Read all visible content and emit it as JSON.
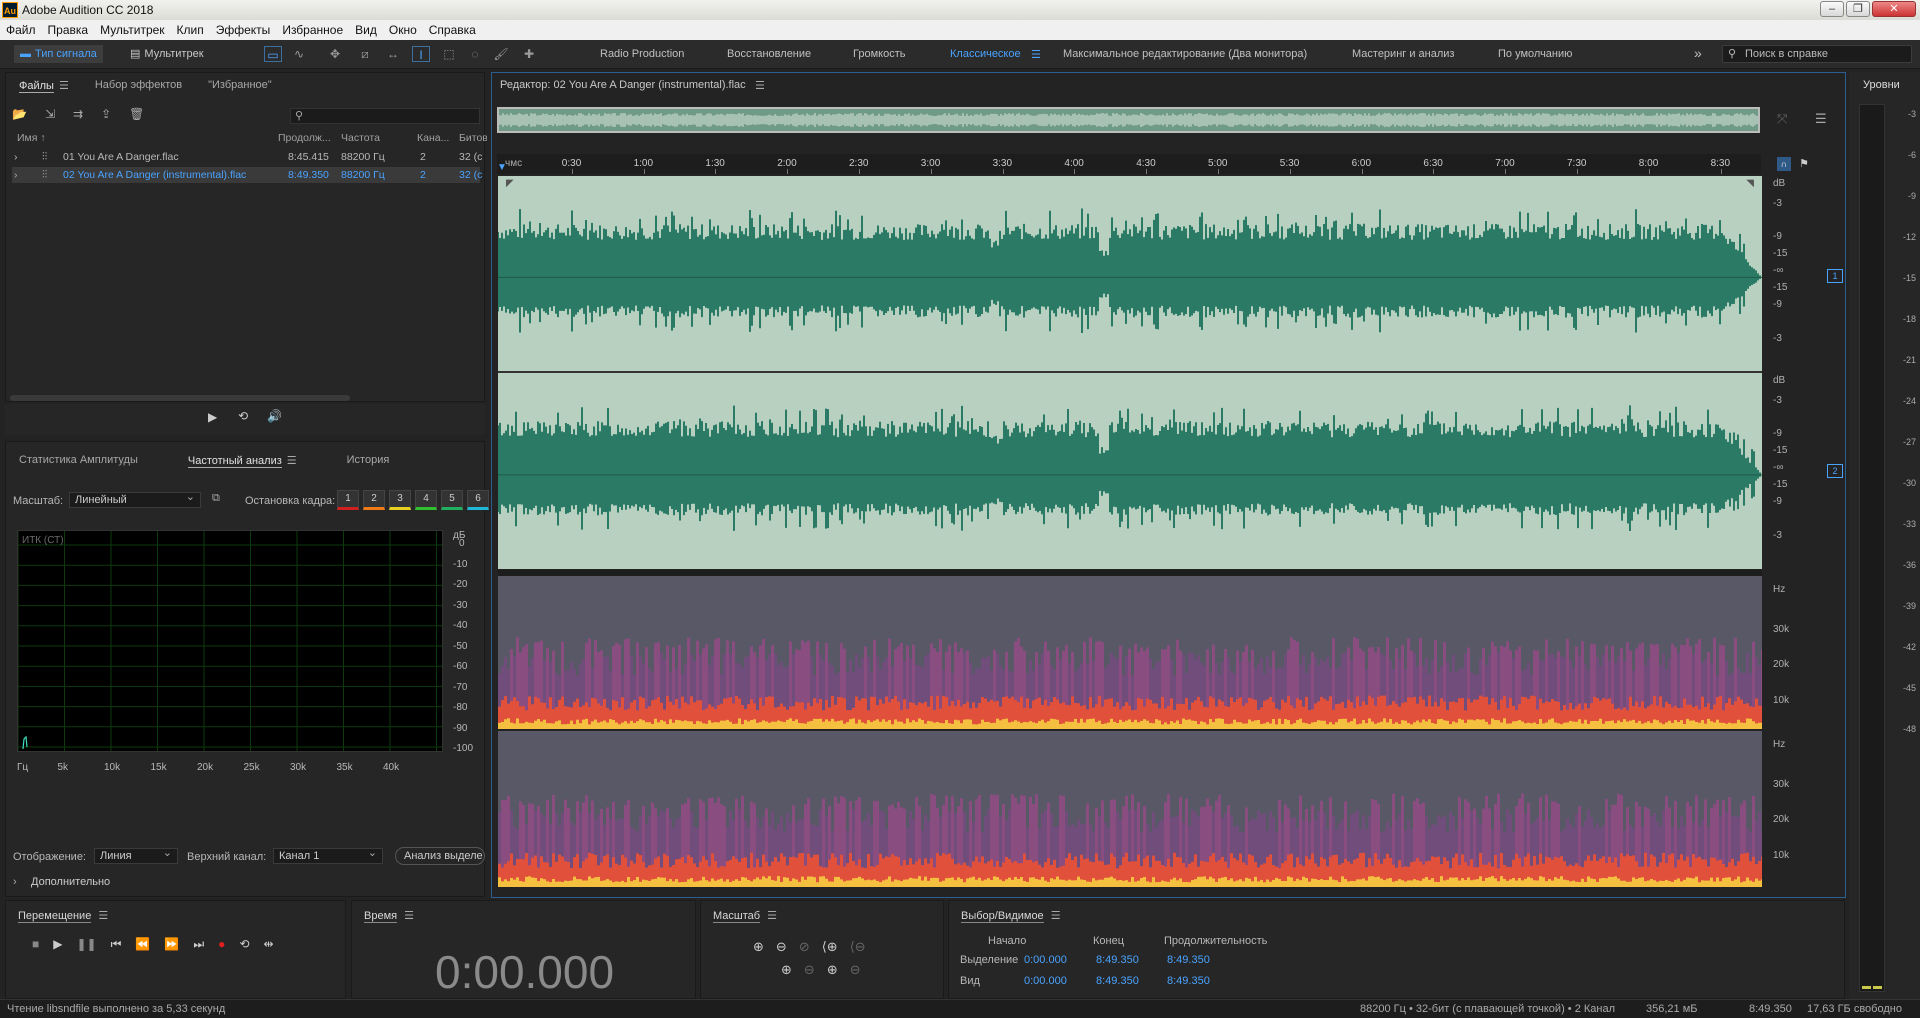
{
  "titlebar": {
    "logo": "Au",
    "title": "Adobe Audition CC 2018"
  },
  "menu": [
    "Файл",
    "Правка",
    "Мультитрек",
    "Клип",
    "Эффекты",
    "Избранное",
    "Вид",
    "Окно",
    "Справка"
  ],
  "toolbar": {
    "waveform_mode": "Тип сигнала",
    "multitrack_mode": "Мультитрек",
    "workspaces": [
      "Radio Production",
      "Восстановление",
      "Громкость",
      "Классическое",
      "Максимальное редактирование (Два монитора)",
      "Мастеринг и анализ",
      "По умолчанию"
    ],
    "active_workspace": "Классическое",
    "overflow": "»",
    "help_placeholder": "Поиск в справке"
  },
  "files_panel": {
    "tabs": [
      "Файлы",
      "Набор эффектов",
      "\"Избранное\""
    ],
    "columns": [
      "Имя",
      "Продолж...",
      "Частота",
      "Кана...",
      "Битов"
    ],
    "rows": [
      {
        "name": "01 You Are A Danger.flac",
        "duration": "8:45.415",
        "rate": "88200 Гц",
        "channels": "2",
        "bits": "32 (с"
      },
      {
        "name": "02 You Are A Danger (instrumental).flac",
        "duration": "8:49.350",
        "rate": "88200 Гц",
        "channels": "2",
        "bits": "32 (с"
      }
    ]
  },
  "analysis_panel": {
    "tabs": [
      "Статистика Амплитуды",
      "Частотный анализ",
      "История"
    ],
    "scale_label": "Масштаб:",
    "scale_value": "Линейный",
    "freeze_label": "Остановка кадра:",
    "freeze_slots": [
      "1",
      "2",
      "3",
      "4",
      "5",
      "6"
    ],
    "freeze_colors": [
      "#d02020",
      "#f07a18",
      "#e8d020",
      "#30c030",
      "#20b060",
      "#20b8d8"
    ],
    "graph_label": "ИТК (СТ)",
    "db_unit": "дБ",
    "db_ticks": [
      "0",
      "-10",
      "-20",
      "-30",
      "-40",
      "-50",
      "-60",
      "-70",
      "-80",
      "-90",
      "-100"
    ],
    "hz_ticks": [
      "Гц",
      "5k",
      "10k",
      "15k",
      "20k",
      "25k",
      "30k",
      "35k",
      "40k"
    ],
    "display_label": "Отображение:",
    "display_value": "Линия",
    "channel_label": "Верхний канал:",
    "channel_value": "Канал 1",
    "analyze_button": "Анализ выделе",
    "advanced": "Дополнительно"
  },
  "editor": {
    "title": "Редактор: 02 You Are A Danger (instrumental).flac",
    "ruler_start": "чмс",
    "ruler_ticks": [
      "0:30",
      "1:00",
      "1:30",
      "2:00",
      "2:30",
      "3:00",
      "3:30",
      "4:00",
      "4:30",
      "5:00",
      "5:30",
      "6:00",
      "6:30",
      "7:00",
      "7:30",
      "8:00",
      "8:30"
    ],
    "db_unit": "dB",
    "db_ticks": [
      "-3",
      "-9",
      "-15",
      "-∞",
      "-15",
      "-9",
      "-3"
    ],
    "hz_unit": "Hz",
    "hz_ticks": [
      "30k",
      "20k",
      "10k"
    ],
    "channels": [
      "1",
      "2"
    ]
  },
  "levels": {
    "title": "Уровни",
    "ticks": [
      "-3",
      "-6",
      "-9",
      "-12",
      "-15",
      "-18",
      "-21",
      "-24",
      "-27",
      "-30",
      "-33",
      "-36",
      "-39",
      "-42",
      "-45",
      "-48"
    ]
  },
  "transport": {
    "title": "Перемещение",
    "record_color": "#e02020"
  },
  "time_panel": {
    "title": "Время",
    "value": "0:00.000"
  },
  "zoom_panel": {
    "title": "Масштаб"
  },
  "selection_panel": {
    "title": "Выбор/Видимое",
    "headers": [
      "Начало",
      "Конец",
      "Продолжительность"
    ],
    "rows": [
      {
        "label": "Выделение",
        "start": "0:00.000",
        "end": "8:49.350",
        "duration": "8:49.350"
      },
      {
        "label": "Вид",
        "start": "0:00.000",
        "end": "8:49.350",
        "duration": "8:49.350"
      }
    ]
  },
  "status": {
    "message": "Чтение libsndfile выполнено за 5,33 секунд",
    "format": "88200 Гц • 32-бит (с плавающей точкой) • 2 Канал",
    "size": "356,21 мБ",
    "duration": "8:49.350",
    "free": "17,63 ГБ свободно"
  },
  "colors": {
    "accent": "#4aa3ff",
    "wave": "#2a7a66",
    "wave_bg": "#b8d0c0"
  }
}
